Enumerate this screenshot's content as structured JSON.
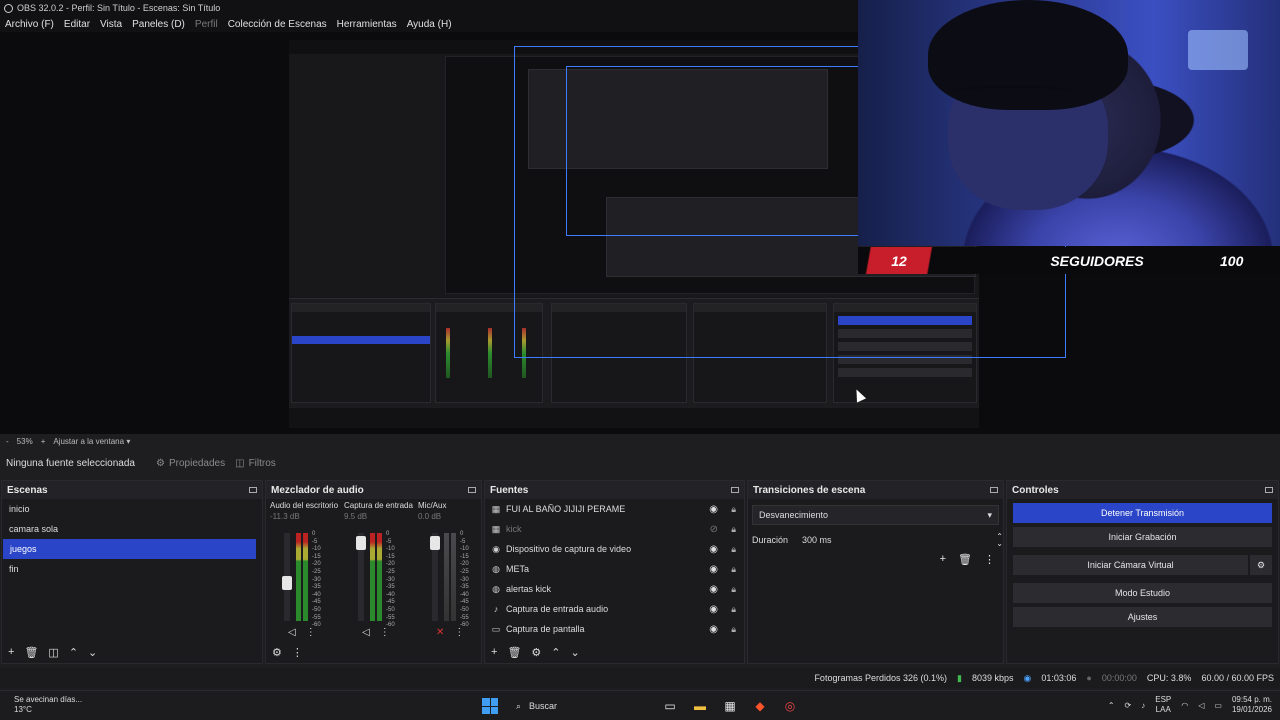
{
  "window": {
    "title": "OBS 32.0.2 - Perfil: Sin Título - Escenas: Sin Título"
  },
  "menu": [
    "Archivo (F)",
    "Editar",
    "Vista",
    "Paneles (D)",
    "Perfil",
    "Colección de Escenas",
    "Herramientas",
    "Ayuda (H)"
  ],
  "overlay": {
    "count": "12",
    "label": "SEGUIDORES",
    "goal": "100"
  },
  "zoom": {
    "minus": "-",
    "value": "53%",
    "plus": "+",
    "fit": "Ajustar a la ventana"
  },
  "source_bar": {
    "no_source": "Ninguna fuente seleccionada",
    "properties": "Propiedades",
    "filters": "Filtros"
  },
  "scenes": {
    "title": "Escenas",
    "items": [
      "inicio",
      "camara sola",
      "juegos",
      "fin"
    ],
    "active_index": 2
  },
  "mixer": {
    "title": "Mezclador de audio",
    "channels": [
      {
        "name": "Audio del escritorio",
        "db": "-11.3 dB",
        "level": 0.42
      },
      {
        "name": "Captura de entrada",
        "db": "9.5 dB",
        "level": 0.96
      },
      {
        "name": "Mic/Aux",
        "db": "0.0 dB",
        "level": 0.96,
        "muted": true
      }
    ],
    "scale": [
      "0",
      "-5",
      "-10",
      "-15",
      "-20",
      "-25",
      "-30",
      "-35",
      "-40",
      "-45",
      "-50",
      "-55",
      "-60"
    ]
  },
  "sources": {
    "title": "Fuentes",
    "items": [
      {
        "icon": "image-icon",
        "glyph": "▦",
        "label": "FUI AL BAÑO JIJIJI PERAME",
        "visible": true
      },
      {
        "icon": "image-icon",
        "glyph": "▦",
        "label": "kick",
        "visible": false
      },
      {
        "icon": "camera-icon",
        "glyph": "◉",
        "label": "Dispositivo de captura de video",
        "visible": true
      },
      {
        "icon": "globe-icon",
        "glyph": "◍",
        "label": "METa",
        "visible": true
      },
      {
        "icon": "globe-icon",
        "glyph": "◍",
        "label": "alertas kick",
        "visible": true
      },
      {
        "icon": "microphone-icon",
        "glyph": "♪",
        "label": "Captura de entrada audio",
        "visible": true
      },
      {
        "icon": "monitor-icon",
        "glyph": "▭",
        "label": "Captura de pantalla",
        "visible": true
      }
    ]
  },
  "transitions": {
    "title": "Transiciones de escena",
    "selected": "Desvanecimiento",
    "duration_label": "Duración",
    "duration_value": "300 ms"
  },
  "controls": {
    "title": "Controles",
    "buttons": [
      "Detener Transmisión",
      "Iniciar Grabación",
      "Iniciar Cámara Virtual",
      "Modo Estudio",
      "Ajustes"
    ]
  },
  "status": {
    "frames": "Fotogramas Perdidos 326 (0.1%)",
    "bitrate": "8039 kbps",
    "live_time": "01:03:06",
    "rec_time": "00:00:00",
    "cpu": "CPU: 3.8%",
    "fps": "60.00 / 60.00 FPS"
  },
  "taskbar": {
    "weather_title": "Se avecinan días...",
    "weather_temp": "13°C",
    "search": "Buscar",
    "lang_top": "ESP",
    "lang_bottom": "LAA",
    "time": "09:54 p. m.",
    "date": "19/01/2026"
  },
  "colors": {
    "accent": "#2a45c7",
    "overlay_red": "#c81d2a",
    "ok_green": "#3fb950"
  }
}
